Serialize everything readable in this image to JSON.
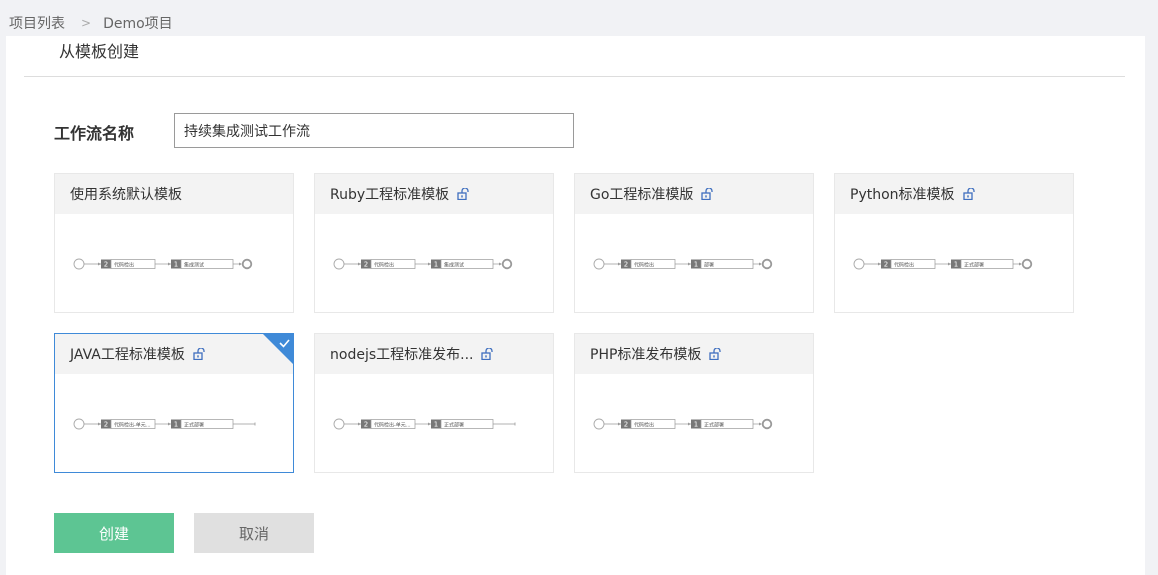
{
  "breadcrumb": {
    "root": "项目列表",
    "separator": ">",
    "current": "Demo项目"
  },
  "page": {
    "title": "从模板创建"
  },
  "form": {
    "name_label": "工作流名称",
    "name_value": "持续集成测试工作流"
  },
  "templates": [
    {
      "name": "使用系统默认模板",
      "locked": false,
      "stage1": "代码检出",
      "stage2": "集成测试",
      "end": "circle"
    },
    {
      "name": "Ruby工程标准模板",
      "locked": true,
      "stage1": "代码检出",
      "stage2": "集成测试",
      "end": "circle"
    },
    {
      "name": "Go工程标准模版",
      "locked": true,
      "stage1": "代码检出",
      "stage2": "部署",
      "end": "circle"
    },
    {
      "name": "Python标准模板",
      "locked": true,
      "stage1": "代码检出",
      "stage2": "正式部署",
      "end": "circle"
    },
    {
      "name": "JAVA工程标准模板",
      "locked": true,
      "stage1": "代码检出-单元...",
      "stage2": "正式部署",
      "end": "line",
      "selected": true
    },
    {
      "name": "nodejs工程标准发布...",
      "locked": true,
      "stage1": "代码检出-单元...",
      "stage2": "正式部署",
      "end": "line"
    },
    {
      "name": "PHP标准发布模板",
      "locked": true,
      "stage1": "代码检出",
      "stage2": "正式部署",
      "end": "circle"
    }
  ],
  "buttons": {
    "create": "创建",
    "cancel": "取消"
  },
  "colors": {
    "primary": "#5dc593",
    "selected_border": "#3f8ad8",
    "lock_icon": "#3f6fbf"
  }
}
